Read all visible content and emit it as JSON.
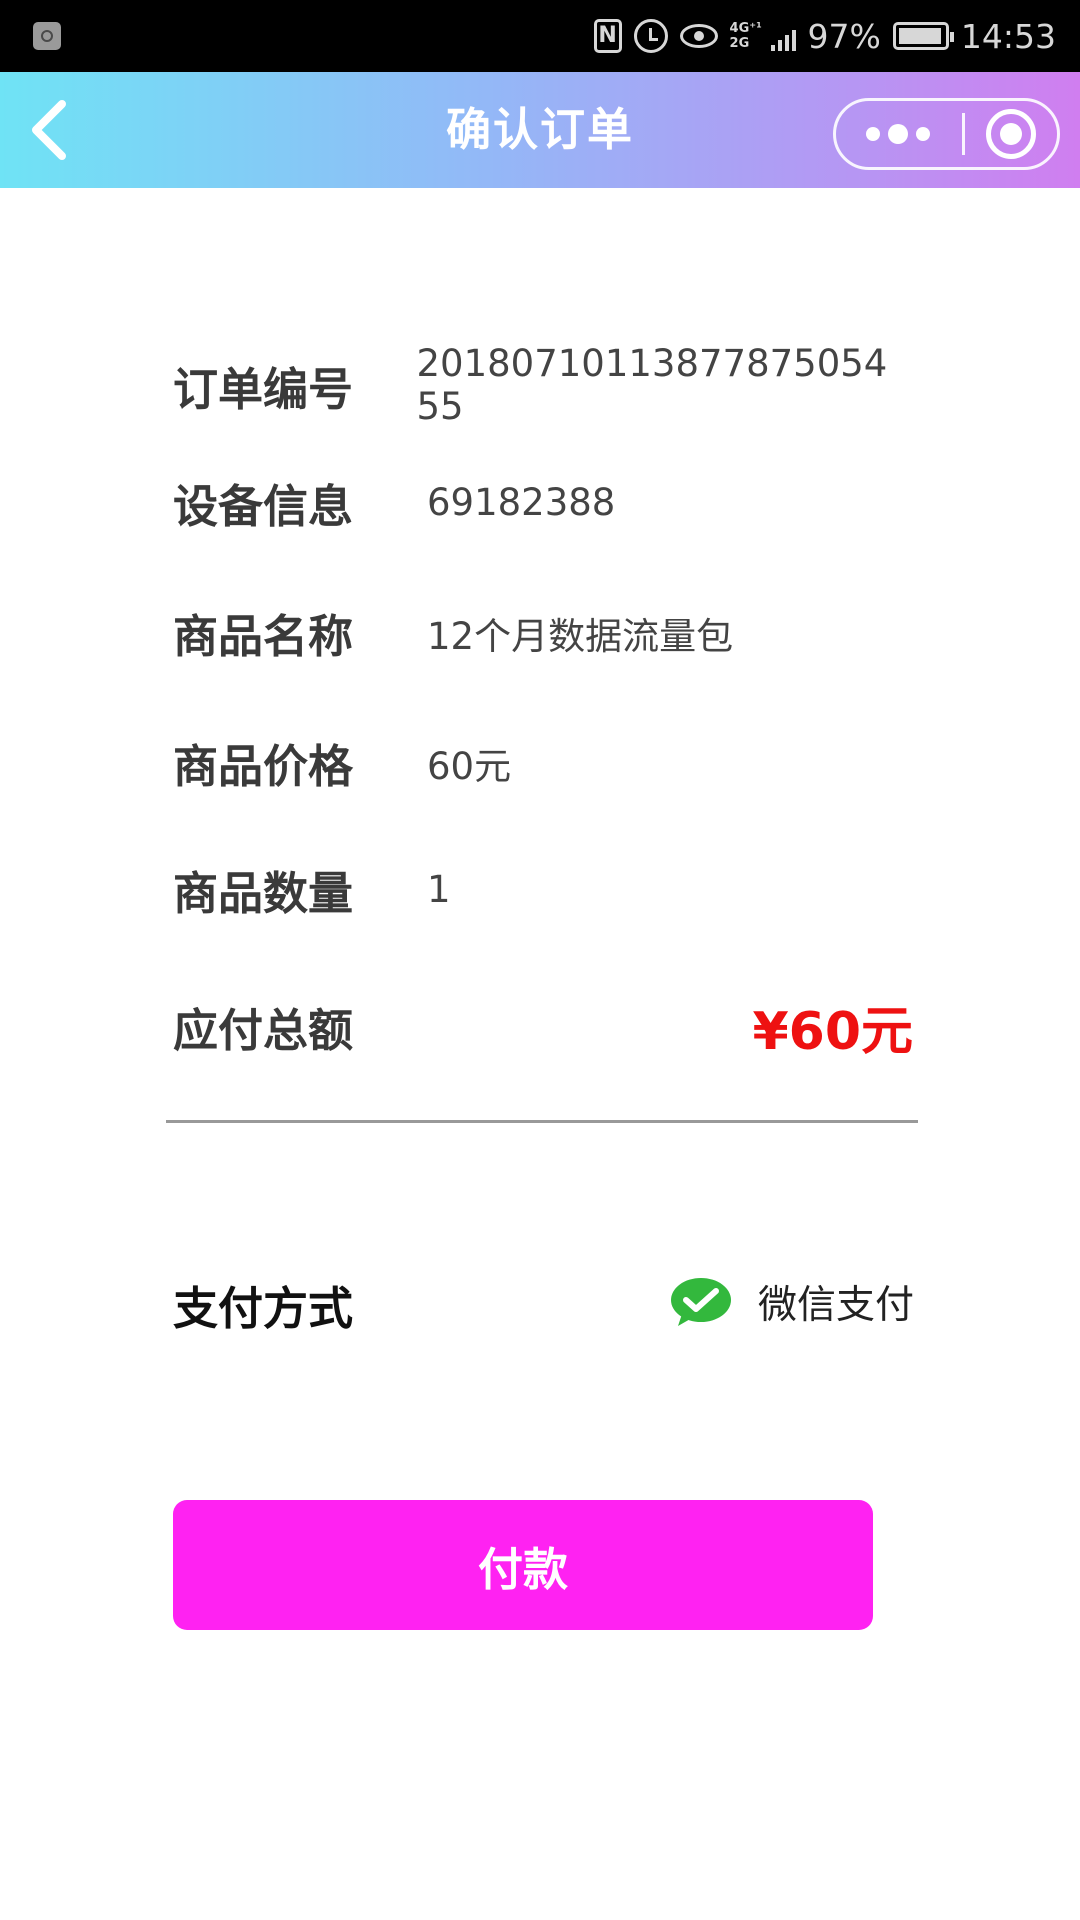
{
  "status_bar": {
    "battery": "97%",
    "time": "14:53",
    "network_top": "4G⁺¹",
    "network_bottom": "2G"
  },
  "nav": {
    "title": "确认订单",
    "gradient_colors": [
      "#6fe3f5",
      "#93b8f7",
      "#b795f3",
      "#d07ef0"
    ]
  },
  "order": {
    "rows": [
      {
        "label": "订单编号",
        "value": "20180710113877875054​55"
      },
      {
        "label": "设备信息",
        "value": "69182388"
      },
      {
        "label": "商品名称",
        "value": "12个月数据流量包"
      },
      {
        "label": "商品价格",
        "value": "60元"
      },
      {
        "label": "商品数量",
        "value": "1"
      }
    ],
    "total_label": "应付总额",
    "total_value": "¥60元",
    "total_color": "#ee1111"
  },
  "payment": {
    "label": "支付方式",
    "option_label": "微信支付",
    "option_icon": "wechat-pay-icon",
    "button_label": "付款",
    "button_color": "#ff22f2"
  }
}
